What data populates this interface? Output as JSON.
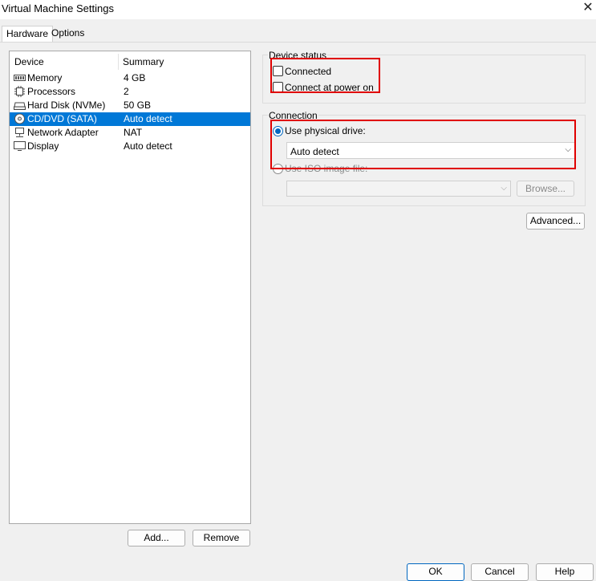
{
  "window": {
    "title": "Virtual Machine Settings",
    "close_glyph": "✕"
  },
  "tabs": [
    {
      "label": "Hardware",
      "active": true
    },
    {
      "label": "Options",
      "active": false
    }
  ],
  "device_list": {
    "columns": [
      "Device",
      "Summary"
    ],
    "rows": [
      {
        "device": "Memory",
        "summary": "4 GB",
        "icon": "memory-icon"
      },
      {
        "device": "Processors",
        "summary": "2",
        "icon": "processor-icon"
      },
      {
        "device": "Hard Disk (NVMe)",
        "summary": "50 GB",
        "icon": "hard-disk-icon"
      },
      {
        "device": "CD/DVD (SATA)",
        "summary": "Auto detect",
        "icon": "cd-dvd-icon",
        "selected": true
      },
      {
        "device": "Network Adapter",
        "summary": "NAT",
        "icon": "network-adapter-icon"
      },
      {
        "device": "Display",
        "summary": "Auto detect",
        "icon": "display-icon"
      }
    ],
    "add_label": "Add...",
    "remove_label": "Remove"
  },
  "device_status": {
    "title": "Device status",
    "connected_label": "Connected",
    "connected_checked": false,
    "connect_power_label": "Connect at power on",
    "connect_power_checked": false
  },
  "connection": {
    "title": "Connection",
    "physical_label": "Use physical drive:",
    "physical_selected": true,
    "physical_value": "Auto detect",
    "iso_label": "Use ISO image file:",
    "iso_selected": false,
    "iso_value": "",
    "browse_label": "Browse..."
  },
  "advanced_label": "Advanced...",
  "footer": {
    "ok": "OK",
    "cancel": "Cancel",
    "help": "Help"
  },
  "highlight_color": "#e00000",
  "selection_color": "#0078d7"
}
